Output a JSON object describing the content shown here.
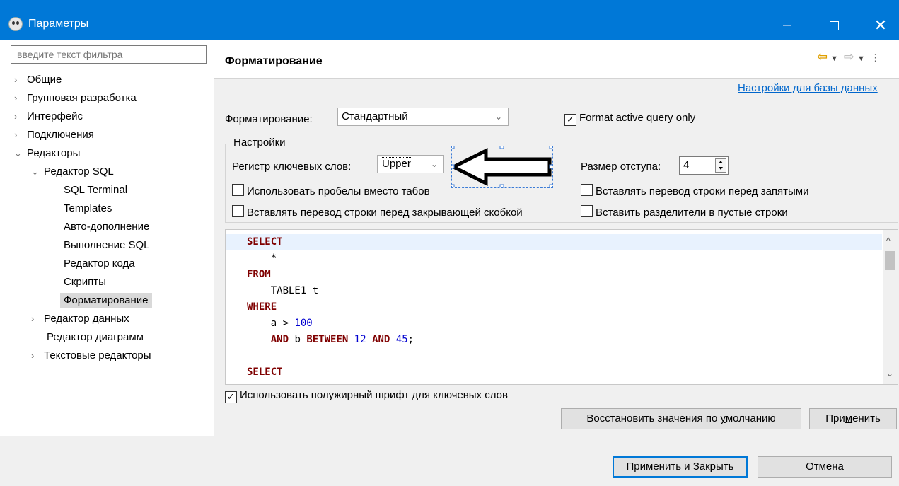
{
  "window": {
    "title": "Параметры"
  },
  "sidebar": {
    "filter_placeholder": "введите текст фильтра",
    "items": [
      {
        "label": "Общие",
        "arrow": "›",
        "level": 0
      },
      {
        "label": "Групповая разработка",
        "arrow": "›",
        "level": 0
      },
      {
        "label": "Интерфейс",
        "arrow": "›",
        "level": 0
      },
      {
        "label": "Подключения",
        "arrow": "›",
        "level": 0
      },
      {
        "label": "Редакторы",
        "arrow": "⌄",
        "level": 0
      },
      {
        "label": "Редактор SQL",
        "arrow": "⌄",
        "level": 1
      },
      {
        "label": "SQL Terminal",
        "arrow": "",
        "level": 2
      },
      {
        "label": "Templates",
        "arrow": "",
        "level": 2
      },
      {
        "label": "Авто-дополнение",
        "arrow": "",
        "level": 2
      },
      {
        "label": "Выполнение SQL",
        "arrow": "",
        "level": 2
      },
      {
        "label": "Редактор кода",
        "arrow": "",
        "level": 2
      },
      {
        "label": "Скрипты",
        "arrow": "",
        "level": 2
      },
      {
        "label": "Форматирование",
        "arrow": "",
        "level": 2,
        "selected": true
      },
      {
        "label": "Редактор данных",
        "arrow": "›",
        "level": 1
      },
      {
        "label": "Редактор диаграмм",
        "arrow": "",
        "level": 1
      },
      {
        "label": "Текстовые редакторы",
        "arrow": "›",
        "level": 1
      }
    ]
  },
  "page": {
    "title": "Форматирование",
    "db_link": "Настройки для базы данных",
    "format_label": "Форматирование:",
    "format_value": "Стандартный",
    "format_active_only": "Format active query only",
    "group_title": "Настройки",
    "keyword_case_label": "Регистр ключевых слов:",
    "keyword_case_value": "Upper",
    "indent_label": "Размер отступа:",
    "indent_value": "4",
    "use_spaces": "Использовать пробелы вместо табов",
    "newline_before_comma": "Вставлять перевод строки перед запятыми",
    "newline_before_bracket": "Вставлять перевод строки перед закрывающей скобкой",
    "insert_separators": "Вставить разделители в пустые строки",
    "bold_keywords": "Использовать полужирный шрифт для ключевых слов",
    "restore_pre": "Восстановить значения по ",
    "restore_mn": "у",
    "restore_post": "молчанию",
    "apply_pre": "При",
    "apply_mn": "м",
    "apply_post": "енить"
  },
  "code": {
    "l1_kw": "SELECT",
    "l2": "    *",
    "l3_kw": "FROM",
    "l4": "    TABLE1 t",
    "l5_kw": "WHERE",
    "l6_a": "    a > ",
    "l6_num": "100",
    "l7_kw1": "AND",
    "l7_b": " b ",
    "l7_kw2": "BETWEEN",
    "l7_num1": "12",
    "l7_kw3": "AND",
    "l7_num2": "45",
    "l7_end": ";",
    "l9_kw": "SELECT"
  },
  "footer": {
    "apply_close": "Применить и Закрыть",
    "cancel": "Отмена"
  },
  "icons": {
    "back": "⇦",
    "forward": "⇨",
    "dropdown": "▼",
    "menu": "⋮",
    "chevron_down": "⌄",
    "scroll_up": "^",
    "scroll_down": "⌄",
    "close": "✕",
    "check": "✓"
  },
  "colors": {
    "titlebar": "#0078d7",
    "keyword": "#7f0000",
    "number": "#0000d0",
    "link": "#0066cc"
  }
}
